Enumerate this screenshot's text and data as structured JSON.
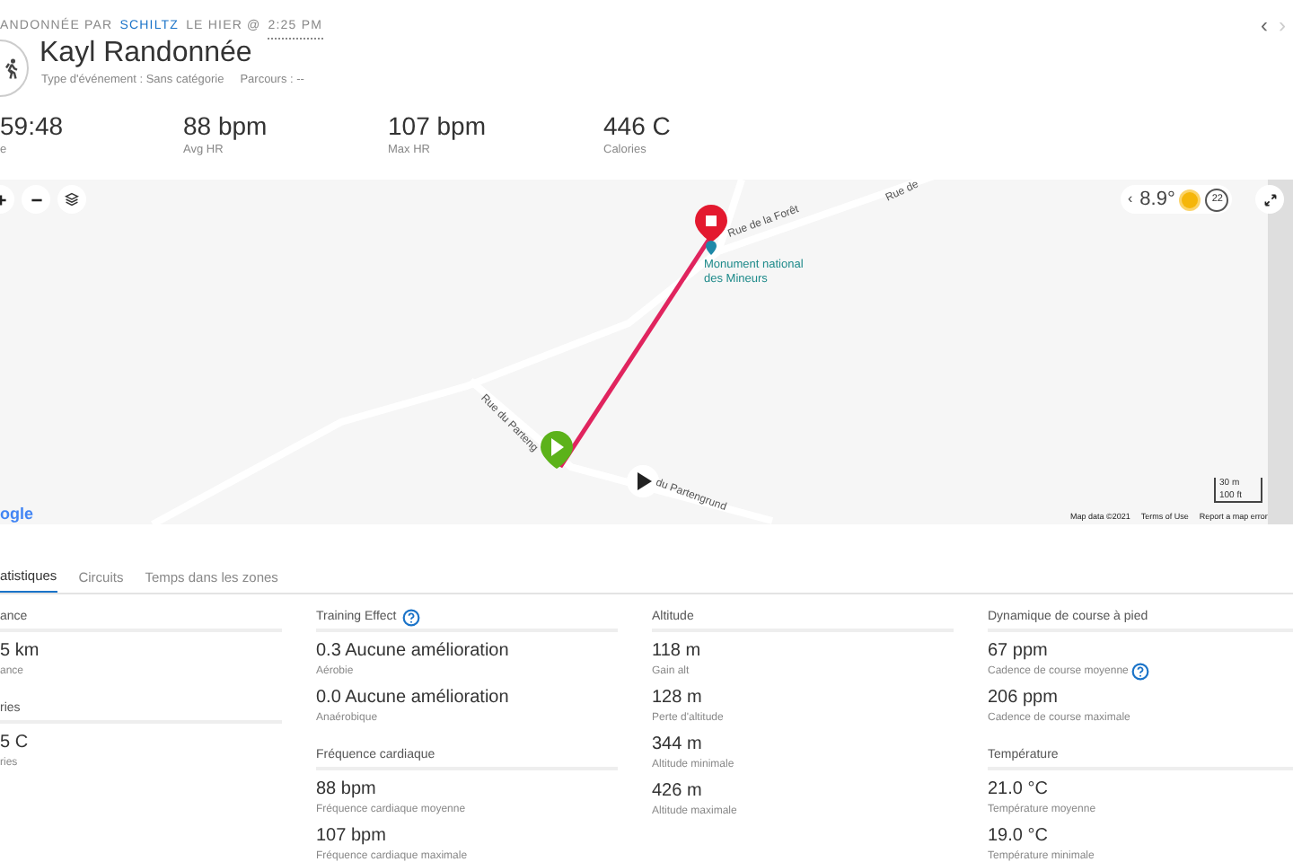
{
  "header": {
    "activity_type": "ANDONNÉE PAR",
    "user": "SCHILTZ",
    "when": "LE HIER @",
    "time": "2:25 PM",
    "title": "Kayl Randonnée",
    "event_type": "Type d'événement : Sans catégorie",
    "course": "Parcours : --",
    "nav": [
      "‹",
      "›"
    ]
  },
  "summary": [
    {
      "value": "59:48",
      "label": "e"
    },
    {
      "value": "88 bpm",
      "label": "Avg HR"
    },
    {
      "value": "107 bpm",
      "label": "Max HR"
    },
    {
      "value": "446 C",
      "label": "Calories"
    }
  ],
  "map": {
    "weather": {
      "back": "‹",
      "temperature": "8.9°",
      "wind": "22"
    },
    "streets": [
      "Rue de la Forêt",
      "Rue du Parteng",
      "du Partengrund",
      "Rue de"
    ],
    "poi": "Monument national des Mineurs",
    "scale": [
      "30 m",
      "100 ft"
    ],
    "attribution": [
      "Map data ©2021",
      "Terms of Use",
      "Report a map error"
    ],
    "logo": "ogle"
  },
  "tabs": [
    {
      "label": "atistiques",
      "selected": true
    },
    {
      "label": "Circuits",
      "selected": false
    },
    {
      "label": "Temps dans les zones",
      "selected": false
    }
  ],
  "columns": [
    [
      {
        "title": "ance",
        "stats": [
          {
            "value": "5 km",
            "label": "ance"
          }
        ]
      },
      {
        "title": "ries",
        "stats": [
          {
            "value": "5 C",
            "label": "ries"
          }
        ]
      }
    ],
    [
      {
        "title": "Training Effect",
        "help": true,
        "stats": [
          {
            "value": "0.3 Aucune amélioration",
            "label": "Aérobie"
          },
          {
            "value": "0.0 Aucune amélioration",
            "label": "Anaérobique"
          }
        ]
      },
      {
        "title": "Fréquence cardiaque",
        "stats": [
          {
            "value": "88 bpm",
            "label": "Fréquence cardiaque moyenne"
          },
          {
            "value": "107 bpm",
            "label": "Fréquence cardiaque maximale"
          }
        ]
      }
    ],
    [
      {
        "title": "Altitude",
        "stats": [
          {
            "value": "118 m",
            "label": "Gain alt"
          },
          {
            "value": "128 m",
            "label": "Perte d'altitude"
          },
          {
            "value": "344 m",
            "label": "Altitude minimale"
          },
          {
            "value": "426 m",
            "label": "Altitude maximale"
          }
        ]
      }
    ],
    [
      {
        "title": "Dynamique de course à pied",
        "stats": [
          {
            "value": "67 ppm",
            "label": "Cadence de course moyenne",
            "help": true
          },
          {
            "value": "206 ppm",
            "label": "Cadence de course maximale"
          }
        ]
      },
      {
        "title": "Température",
        "stats": [
          {
            "value": "21.0 °C",
            "label": "Température moyenne"
          },
          {
            "value": "19.0 °C",
            "label": "Température minimale"
          }
        ]
      }
    ]
  ]
}
